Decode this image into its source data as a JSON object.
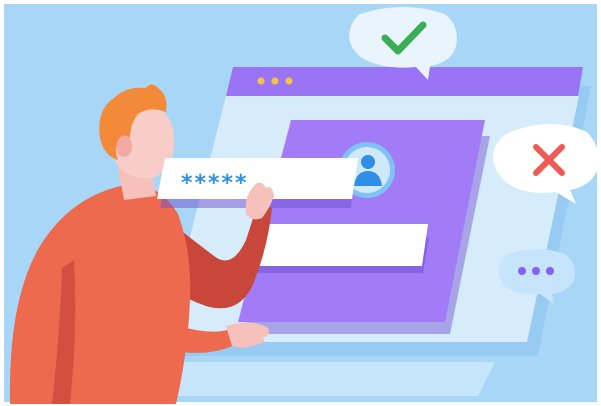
{
  "login_form": {
    "password_mask": "*****",
    "second_field_value": ""
  },
  "bubbles": {
    "success_icon": "checkmark-icon",
    "error_icon": "cross-icon",
    "typing_icon": "ellipsis-icon"
  },
  "icons": {
    "avatar": "user-icon",
    "window_controls": "three-dots-icon"
  },
  "colors": {
    "background": "#a7d6f7",
    "window_bar": "#9a74f4",
    "window_body": "#d6ecfb",
    "card": "#a27cf6",
    "card_shadow": "#6f4fcf",
    "accent_blue": "#2f8fe6",
    "success": "#3aae54",
    "error": "#ee5a55",
    "shirt": "#ee6a4f",
    "hair": "#f28a3a"
  }
}
